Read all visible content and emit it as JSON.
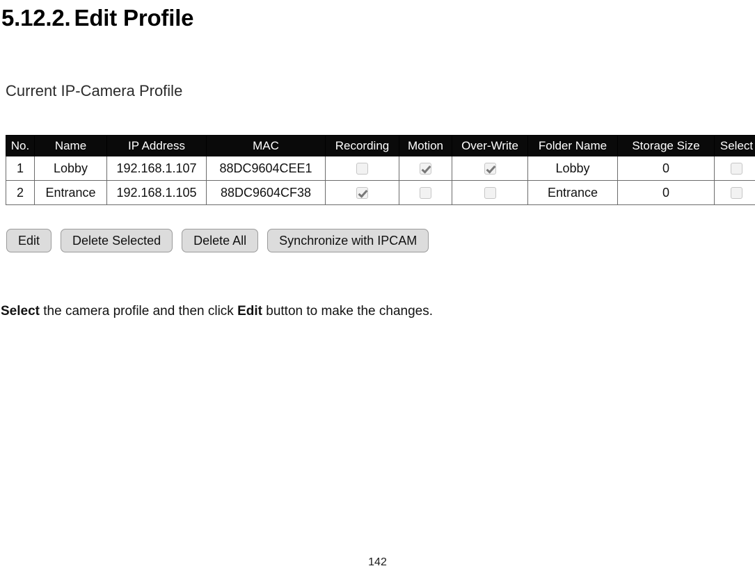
{
  "heading": {
    "number": "5.12.2.",
    "title": "Edit Profile"
  },
  "section": {
    "subtitle": "Current IP-Camera Profile"
  },
  "table": {
    "columns": [
      "No.",
      "Name",
      "IP Address",
      "MAC",
      "Recording",
      "Motion",
      "Over-Write",
      "Folder Name",
      "Storage Size",
      "Select"
    ],
    "rows": [
      {
        "no": "1",
        "name": "Lobby",
        "ip_address": "192.168.1.107",
        "mac": "88DC9604CEE1",
        "recording": false,
        "motion": true,
        "over_write": true,
        "folder_name": "Lobby",
        "storage_size": "0",
        "select": false
      },
      {
        "no": "2",
        "name": "Entrance",
        "ip_address": "192.168.1.105",
        "mac": "88DC9604CF38",
        "recording": true,
        "motion": false,
        "over_write": false,
        "folder_name": "Entrance",
        "storage_size": "0",
        "select": false
      }
    ]
  },
  "buttons": {
    "edit": "Edit",
    "delete_selected": "Delete Selected",
    "delete_all": "Delete All",
    "synchronize": "Synchronize with IPCAM"
  },
  "note": {
    "bold_lead": "Select",
    "middle": " the camera profile and then click ",
    "bold_edit": "Edit",
    "tail": " button to make the changes."
  },
  "footer": {
    "page_number": "142"
  },
  "colors": {
    "header_bg": "#0a0a0a",
    "header_text": "#ffffff",
    "cell_border": "#6b6b6b",
    "button_bg": "#dcdcdc",
    "button_border": "#9a9a9a",
    "checkbox_bg": "#f2f2f2",
    "check_mark": "#787878"
  }
}
